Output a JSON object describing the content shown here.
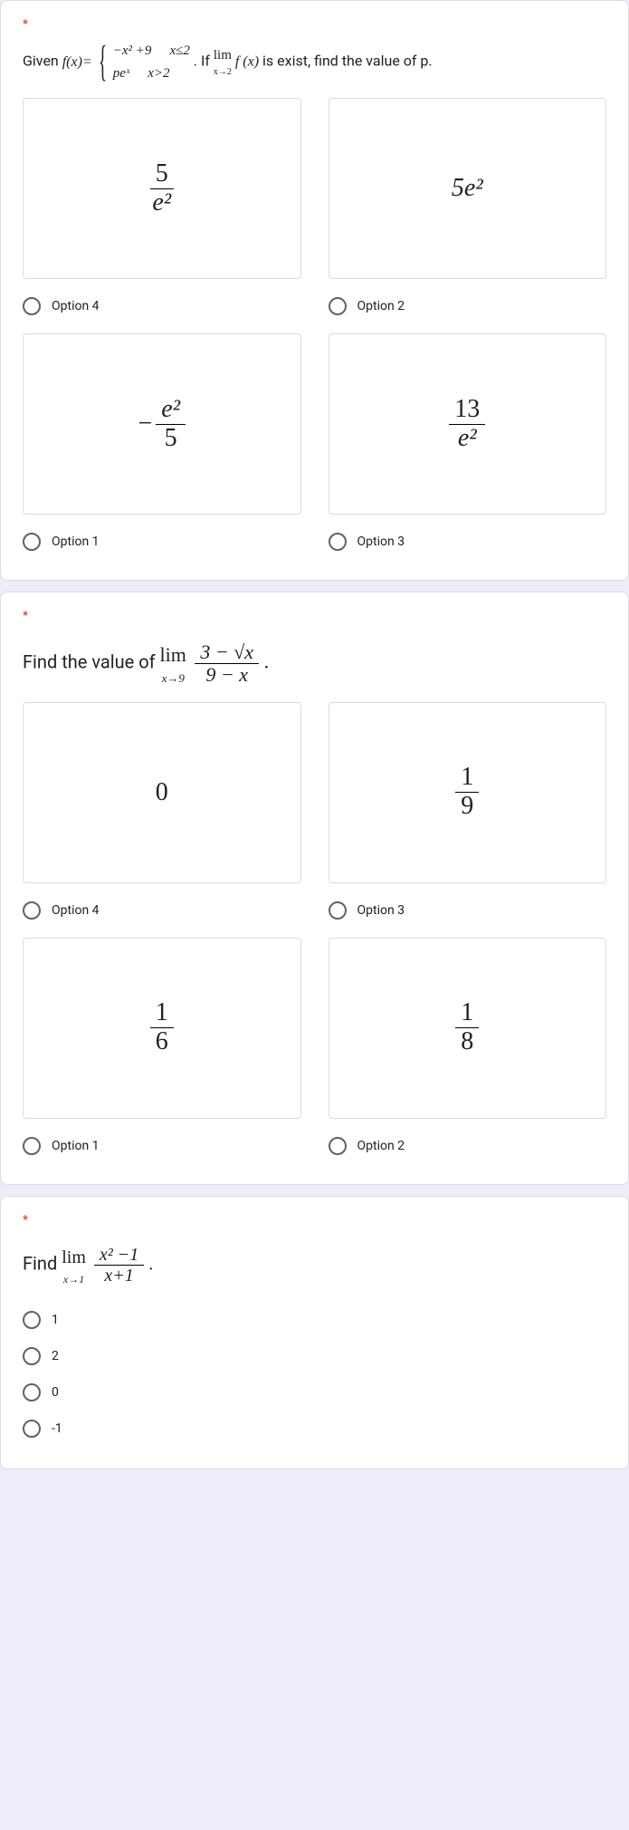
{
  "q1": {
    "required_mark": "*",
    "text_prefix": "Given ",
    "fx_label": "f(x)=",
    "piece1_expr": "−x² +9",
    "piece1_cond": "x≤2",
    "piece2_expr": "peˣ",
    "piece2_cond": "x>2",
    "text_mid": ". If ",
    "lim_label": "lim",
    "lim_sub": "x→2",
    "lim_fx": "f (x)",
    "text_suffix": " is exist, find the value of p.",
    "opts": {
      "a": {
        "num": "5",
        "den": "e²",
        "label": "Option 4"
      },
      "b": {
        "val": "5e²",
        "label": "Option 2"
      },
      "c": {
        "neg": "−",
        "num": "e²",
        "den": "5",
        "label": "Option 1"
      },
      "d": {
        "num": "13",
        "den": "e²",
        "label": "Option 3"
      }
    }
  },
  "q2": {
    "required_mark": "*",
    "text_prefix": "Find the value of ",
    "lim_label": "lim",
    "lim_sub": "x→9",
    "frac_num": "3 − √x",
    "frac_den": "9 − x",
    "period": ".",
    "opts": {
      "a": {
        "val": "0",
        "label": "Option 4"
      },
      "b": {
        "num": "1",
        "den": "9",
        "label": "Option 3"
      },
      "c": {
        "num": "1",
        "den": "6",
        "label": "Option 1"
      },
      "d": {
        "num": "1",
        "den": "8",
        "label": "Option 2"
      }
    }
  },
  "q3": {
    "required_mark": "*",
    "text_prefix": "Find ",
    "lim_label": "lim",
    "lim_sub": "x→1",
    "frac_num": "x² −1",
    "frac_den": "x+1",
    "period": ".",
    "opts": {
      "a": "1",
      "b": "2",
      "c": "0",
      "d": "-1"
    }
  }
}
